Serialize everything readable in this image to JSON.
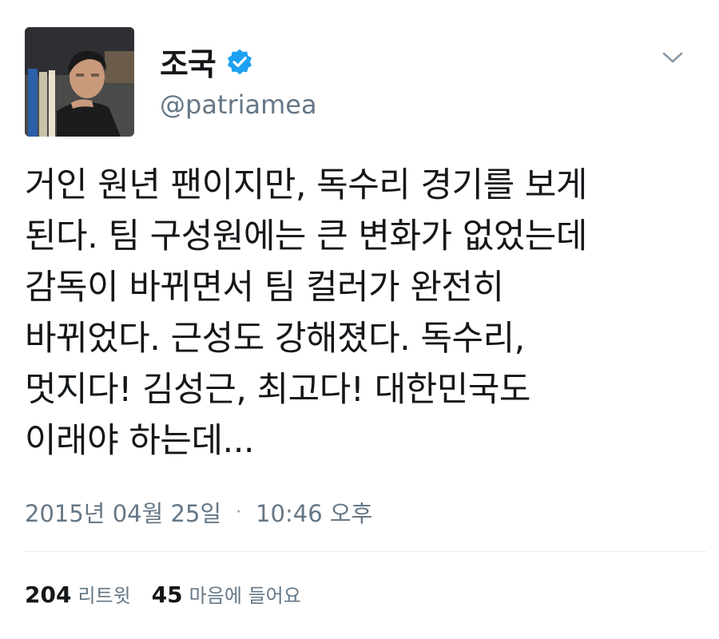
{
  "user": {
    "display_name": "조국",
    "handle": "@patriamea",
    "verified": true
  },
  "tweet": {
    "text": "거인 원년 팬이지만, 독수리 경기를 보게\n된다. 팀 구성원에는 큰 변화가 없었는데\n감독이 바뀌면서 팀 컬러가 완전히\n바뀌었다. 근성도 강해졌다. 독수리,\n멋지다! 김성근, 최고다! 대한민국도\n이래야 하는데...",
    "date": "2015년 04월 25일",
    "separator": "·",
    "time": "10:46 오후"
  },
  "stats": {
    "retweets_count": "204",
    "retweets_label": "리트윗",
    "likes_count": "45",
    "likes_label": "마음에 들어요"
  },
  "colors": {
    "verified_blue": "#1da1f2",
    "secondary_text": "#657786",
    "primary_text": "#14171a",
    "divider": "#e6ecf0"
  },
  "icons": {
    "verified": "verified-badge-icon",
    "menu": "chevron-down-icon"
  }
}
